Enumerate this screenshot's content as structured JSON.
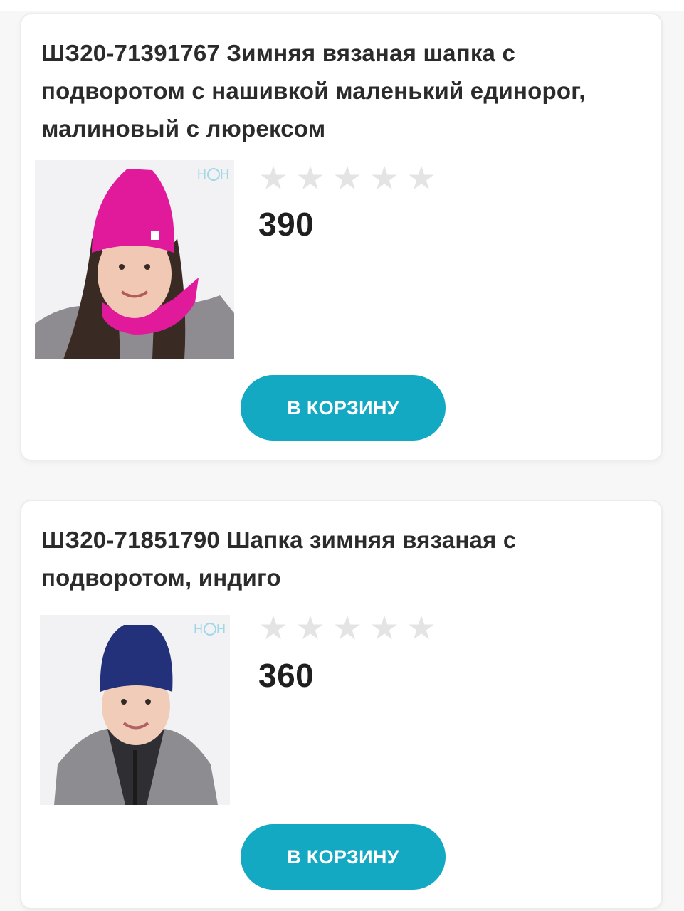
{
  "products": [
    {
      "title": "ШЗ20-71391767 Зимняя вязаная шапка с подворотом с нашивкой маленький единорог, малиновый с люрексом",
      "price": "390",
      "rating": 0,
      "rating_max": 5,
      "cart_label": "В КОРЗИНУ",
      "photo_icon": "girl-magenta-hat-photo",
      "hat_color": "#e01a9a"
    },
    {
      "title": "ШЗ20-71851790 Шапка зимняя вязаная с подворотом, индиго",
      "price": "360",
      "rating": 0,
      "rating_max": 5,
      "cart_label": "В КОРЗИНУ",
      "photo_icon": "boy-indigo-hat-photo",
      "hat_color": "#23317a"
    }
  ],
  "colors": {
    "accent": "#14a9c3",
    "star_empty": "#e4e4e4",
    "text": "#2b2b2b"
  }
}
